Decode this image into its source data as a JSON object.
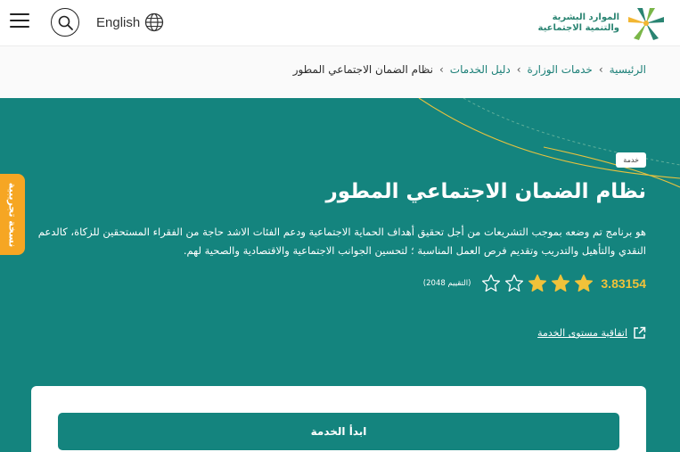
{
  "header": {
    "lang_label": "English",
    "logo_line1": "الموارد البشرية",
    "logo_line2": "والتنمية الاجتماعية"
  },
  "breadcrumb": {
    "home": "الرئيسية",
    "services": "خدمات الوزارة",
    "guide": "دليل الخدمات",
    "current": "نظام الضمان الاجتماعي المطور"
  },
  "hero": {
    "badge": "خدمة",
    "title": "نظام الضمان الاجتماعي المطور",
    "description": "هو برنامج تم وضعه بموجب التشريعات من أجل تحقيق أهداف الحماية الاجتماعية ودعم الفئات الاشد حاجة من الفقراء المستحقين للزكاة، كالدعم النقدي والتأهيل والتدريب وتقديم فرص العمل المناسبة ؛ لتحسين الجوانب الاجتماعية والاقتصادية والصحية لهم.",
    "rating_value": "3.83154",
    "rating_filled": 3,
    "rating_max": 5,
    "rating_count": "(التقييم 2048)",
    "sla_link": "اتفاقية مستوى الخدمة"
  },
  "side_tab": {
    "label": "نسخة تجريبية"
  },
  "card": {
    "start_button": "ابدأ الخدمة"
  },
  "colors": {
    "teal": "#14847e",
    "star_gold": "#f1c23a",
    "orange": "#f6a623"
  }
}
